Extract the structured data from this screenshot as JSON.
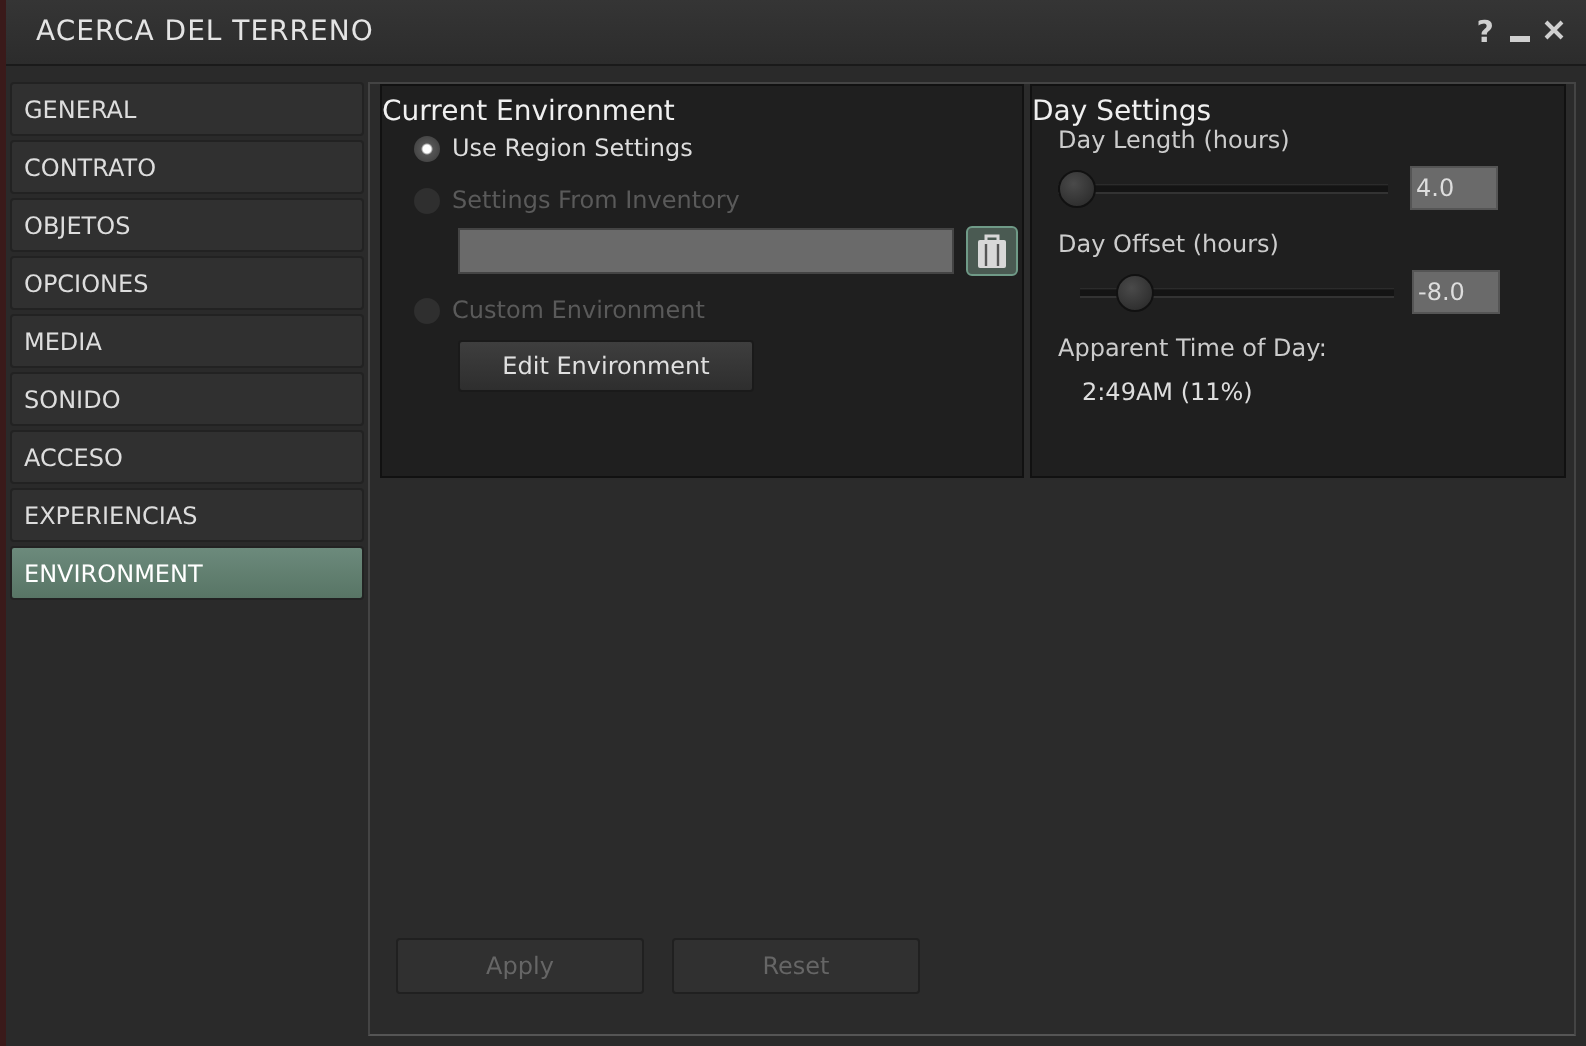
{
  "window": {
    "title": "ACERCA DEL TERRENO",
    "help": "?"
  },
  "sidebar": {
    "items": [
      {
        "label": "GENERAL",
        "selected": false
      },
      {
        "label": "CONTRATO",
        "selected": false
      },
      {
        "label": "OBJETOS",
        "selected": false
      },
      {
        "label": "OPCIONES",
        "selected": false
      },
      {
        "label": "MEDIA",
        "selected": false
      },
      {
        "label": "SONIDO",
        "selected": false
      },
      {
        "label": "ACCESO",
        "selected": false
      },
      {
        "label": "EXPERIENCIAS",
        "selected": false
      },
      {
        "label": "ENVIRONMENT",
        "selected": true
      }
    ]
  },
  "current_environment": {
    "title": "Current Environment",
    "options": [
      {
        "label": "Use Region Settings",
        "selected": true,
        "disabled": false
      },
      {
        "label": "Settings From Inventory",
        "selected": false,
        "disabled": true
      },
      {
        "label": "Custom Environment",
        "selected": false,
        "disabled": true
      }
    ],
    "edit_button": "Edit Environment"
  },
  "day_settings": {
    "title": "Day Settings",
    "sliders": [
      {
        "label": "Day Length (hours)",
        "level": 0.0,
        "value": "4.0"
      },
      {
        "label": "Day Offset (hours)",
        "level": 0.17,
        "value": "-8.0"
      }
    ],
    "time_label": "Apparent Time of Day:",
    "time_value": "2:49AM (11%)"
  },
  "buttons": [
    {
      "label": "Apply",
      "disabled": true
    },
    {
      "label": "Reset",
      "disabled": true
    }
  ]
}
